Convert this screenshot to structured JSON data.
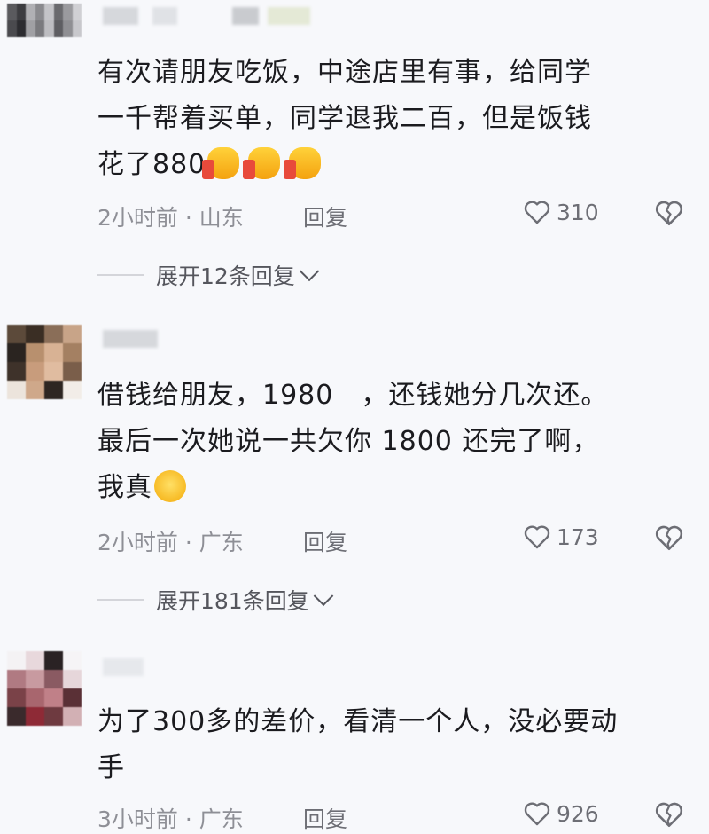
{
  "comments": [
    {
      "text_lines": [
        "有次请朋友吃饭，中途店里有事，给同学",
        "一千帮着买单，同学退我二百，但是饭钱",
        "花了880"
      ],
      "emoji": [
        "thumbs-up-icon",
        "thumbs-up-icon",
        "thumbs-up-icon"
      ],
      "time_location": "2小时前 · 山东",
      "reply_label": "回复",
      "likes": "310",
      "expand_label": "展开12条回复"
    },
    {
      "text_lines": [
        "借钱给朋友，1980　，还钱她分几次还。",
        "最后一次她说一共欠你 1800 还完了啊，",
        "我真"
      ],
      "emoji": [
        "grinning-sweat-icon"
      ],
      "time_location": "2小时前 · 广东",
      "reply_label": "回复",
      "likes": "173",
      "expand_label": "展开181条回复"
    },
    {
      "text_lines": [
        "为了300多的差价，看清一个人，没必要动",
        "手"
      ],
      "emoji": [],
      "time_location": "3小时前 · 广东",
      "reply_label": "回复",
      "likes": "926"
    }
  ],
  "colors": {
    "background": "#f7f8fb",
    "text": "#1b1b1f",
    "meta": "#8e8f96"
  }
}
